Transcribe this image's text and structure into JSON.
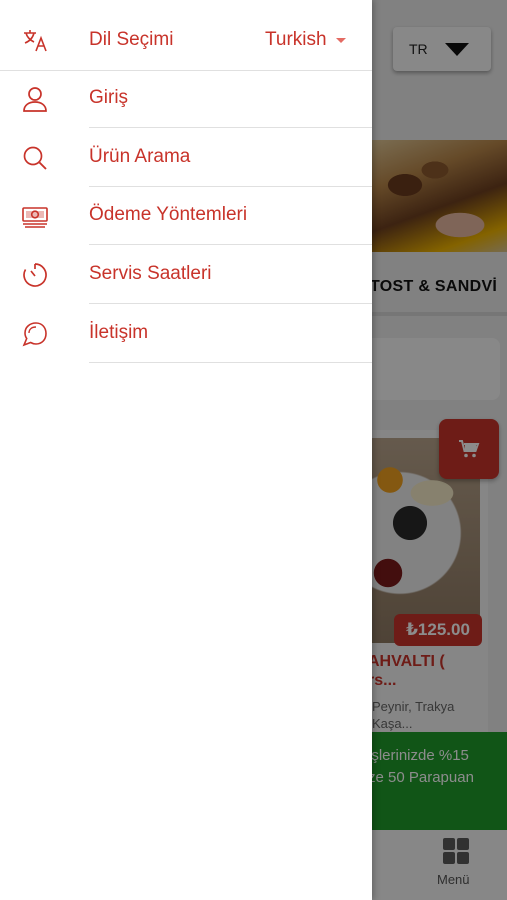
{
  "background": {
    "language_code": "TR",
    "category_title": "TOST & SANDVİ",
    "cart_icon": "cart-icon",
    "product": {
      "price": "₺125.00",
      "name_line1": "AHVALTI (",
      "name_line2": "rs...",
      "desc_line1": "Peynir, Trakya",
      "desc_line2": "Kaşa..."
    },
    "promo": {
      "line1": "işlerinizde %15",
      "line2": "ze 50 Parapuan"
    },
    "bottom_tab": {
      "label": "Menü",
      "icon": "grid-icon"
    }
  },
  "drawer": {
    "language": {
      "label": "Dil Seçimi",
      "value": "Turkish",
      "icon": "translate-icon"
    },
    "items": [
      {
        "label": "Giriş",
        "icon": "user-icon"
      },
      {
        "label": "Ürün Arama",
        "icon": "search-icon"
      },
      {
        "label": "Ödeme Yöntemleri",
        "icon": "money-icon"
      },
      {
        "label": "Servis Saatleri",
        "icon": "timer-icon"
      },
      {
        "label": "İletişim",
        "icon": "chat-icon"
      }
    ]
  },
  "colors": {
    "accent": "#c8332a",
    "promo": "#1f9b2a",
    "divider": "#e0e0e0"
  }
}
